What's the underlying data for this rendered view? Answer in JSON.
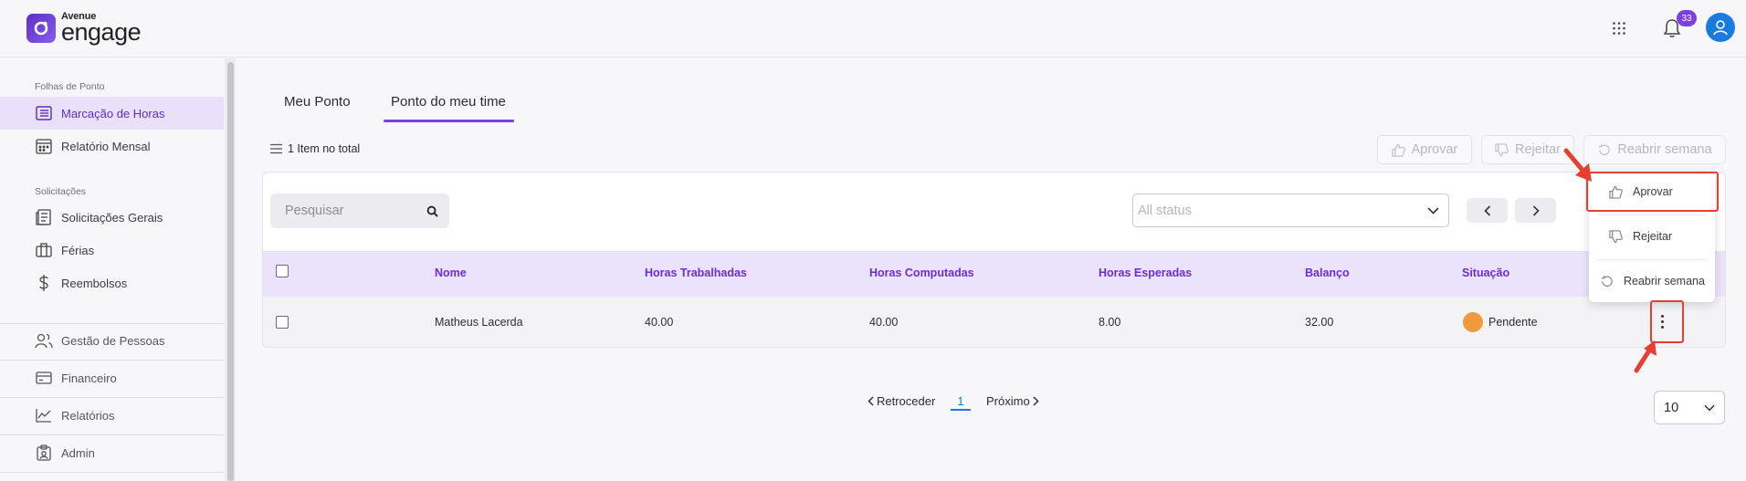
{
  "brand": {
    "small": "Avenue",
    "big": "engage"
  },
  "header": {
    "notification_count": "33",
    "icons": [
      "apps-grid-icon",
      "bell-icon",
      "user-avatar-icon"
    ]
  },
  "sidebar": {
    "section_folhas": "Folhas de Ponto",
    "marcacao": "Marcação de Horas",
    "relatorio_mensal": "Relatório Mensal",
    "section_solicitacoes": "Solicitações",
    "solicitacoes_gerais": "Solicitações Gerais",
    "ferias": "Férias",
    "reembolsos": "Reembolsos",
    "gestao_pessoas": "Gestão de Pessoas",
    "financeiro": "Financeiro",
    "relatorios": "Relatórios",
    "admin": "Admin"
  },
  "tabs": {
    "meu_ponto": "Meu Ponto",
    "ponto_time": "Ponto do meu time"
  },
  "summary": {
    "total": "1 Item no total"
  },
  "actions": {
    "aprovar": "Aprovar",
    "rejeitar": "Rejeitar",
    "reabrir": "Reabrir semana"
  },
  "filters": {
    "search_placeholder": "Pesquisar",
    "status_placeholder": "All status"
  },
  "table": {
    "headers": {
      "nome": "Nome",
      "horas_trabalhadas": "Horas Trabalhadas",
      "horas_computadas": "Horas Computadas",
      "horas_esperadas": "Horas Esperadas",
      "balanco": "Balanço",
      "situacao": "Situação"
    },
    "rows": [
      {
        "nome": "Matheus Lacerda",
        "horas_trabalhadas": "40.00",
        "horas_computadas": "40.00",
        "horas_esperadas": "8.00",
        "balanco": "32.00",
        "situacao": "Pendente"
      }
    ]
  },
  "row_menu": {
    "aprovar": "Aprovar",
    "rejeitar": "Rejeitar",
    "reabrir": "Reabrir semana"
  },
  "pagination": {
    "prev": "Retroceder",
    "page": "1",
    "next": "Próximo",
    "page_size": "10"
  },
  "colors": {
    "accent": "#7b3fe4",
    "active_bg": "#ebe0fb",
    "header_row": "#ebe2fb",
    "pending": "#f09a3e",
    "annotation": "#e63e30"
  }
}
